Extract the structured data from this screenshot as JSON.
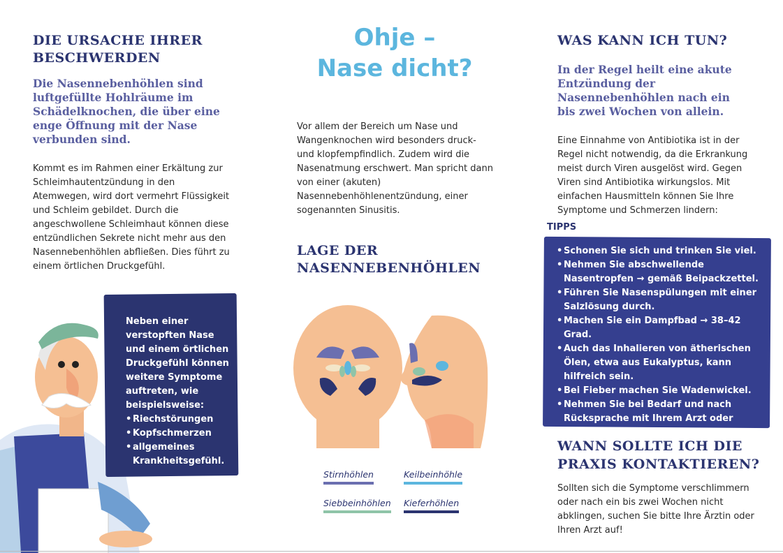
{
  "left": {
    "heading": "DIE URSACHE IHRER BESCHWERDEN",
    "lead": "Die Nasennebenhöhlen sind luftgefüllte Hohlräume im Schädelknochen, die über eine enge Öffnung mit der Nase verbunden sind.",
    "body": "Kommt es im Rahmen einer Erkältung zur Schleimhautentzündung in den Atemwegen, wird dort vermehrt Flüssigkeit und Schleim gebildet. Durch die angeschwollene Schleimhaut können diese entzündlichen Sekrete nicht mehr aus den Nasennebenhöhlen abfließen. Dies führt zu einem örtlichen Druckgefühl.",
    "box_intro": "Neben einer verstopften Nase und einem örtlichen Druckgefühl können weitere Symptome auftreten, wie beispielsweise:",
    "box_items": [
      "Riechstörungen",
      "Kopfschmerzen",
      "allgemeines Krankheitsgefühl."
    ]
  },
  "middle": {
    "title_line1": "Ohje –",
    "title_line2": "Nase dicht?",
    "body": "Vor allem der Bereich um Nase und Wangenknochen wird besonders druck- und klopfempfindlich. Zudem wird die Nasenatmung erschwert. Man spricht dann von einer (akuten) Nasennebenhöhlenentzündung, einer sogenannten Sinusitis.",
    "heading": "LAGE DER NASENNEBENHÖHLEN",
    "legend": [
      {
        "label": "Stirnhöhlen",
        "color": "#6b6fb0"
      },
      {
        "label": "Keilbeinhöhle",
        "color": "#5cb6de"
      },
      {
        "label": "Siebbeinhöhlen",
        "color": "#8fc4a8"
      },
      {
        "label": "Kieferhöhlen",
        "color": "#2b3470"
      }
    ]
  },
  "right": {
    "heading": "WAS KANN ICH TUN?",
    "lead": "In der Regel heilt eine akute Entzündung der Nasennebenhöhlen nach ein bis zwei Wochen von allein.",
    "body": "Eine Einnahme von Antibiotika ist in der Regel nicht notwendig, da die Erkrankung meist durch Viren ausgelöst wird. Gegen Viren sind Antibiotika wirkungslos. Mit einfachen Hausmitteln können Sie Ihre Symptome und Schmerzen lindern:",
    "tips_label": "TIPPS",
    "tips": [
      "Schonen Sie sich und trinken Sie viel.",
      "Nehmen Sie abschwellende Nasentropfen → gemäß Beipackzettel.",
      "Führen Sie Nasenspülungen mit einer Salzlösung durch.",
      "Machen Sie ein Dampfbad → 38–42 Grad.",
      "Auch das Inhalieren von ätherischen Ölen, etwa aus Eukalyptus, kann hilfreich sein.",
      "Bei Fieber machen Sie Wadenwickel.",
      "Nehmen Sie bei Bedarf und nach Rücksprache mit Ihrem Arzt oder Apotheker ein Schmerzmittel, wie etwa Ibuprofen oder Paracetamol, ein."
    ],
    "heading2": "WANN SOLLTE ICH DIE PRAXIS KONTAKTIEREN?",
    "body2": "Sollten sich die Symptome verschlimmern oder nach ein bis zwei Wochen nicht abklingen, suchen Sie bitte Ihre Ärztin oder Ihren Arzt auf!"
  },
  "colors": {
    "navy": "#2b3470",
    "title_blue": "#5cb6de",
    "tips_box": "#353f8f",
    "skin": "#f5bf93"
  }
}
